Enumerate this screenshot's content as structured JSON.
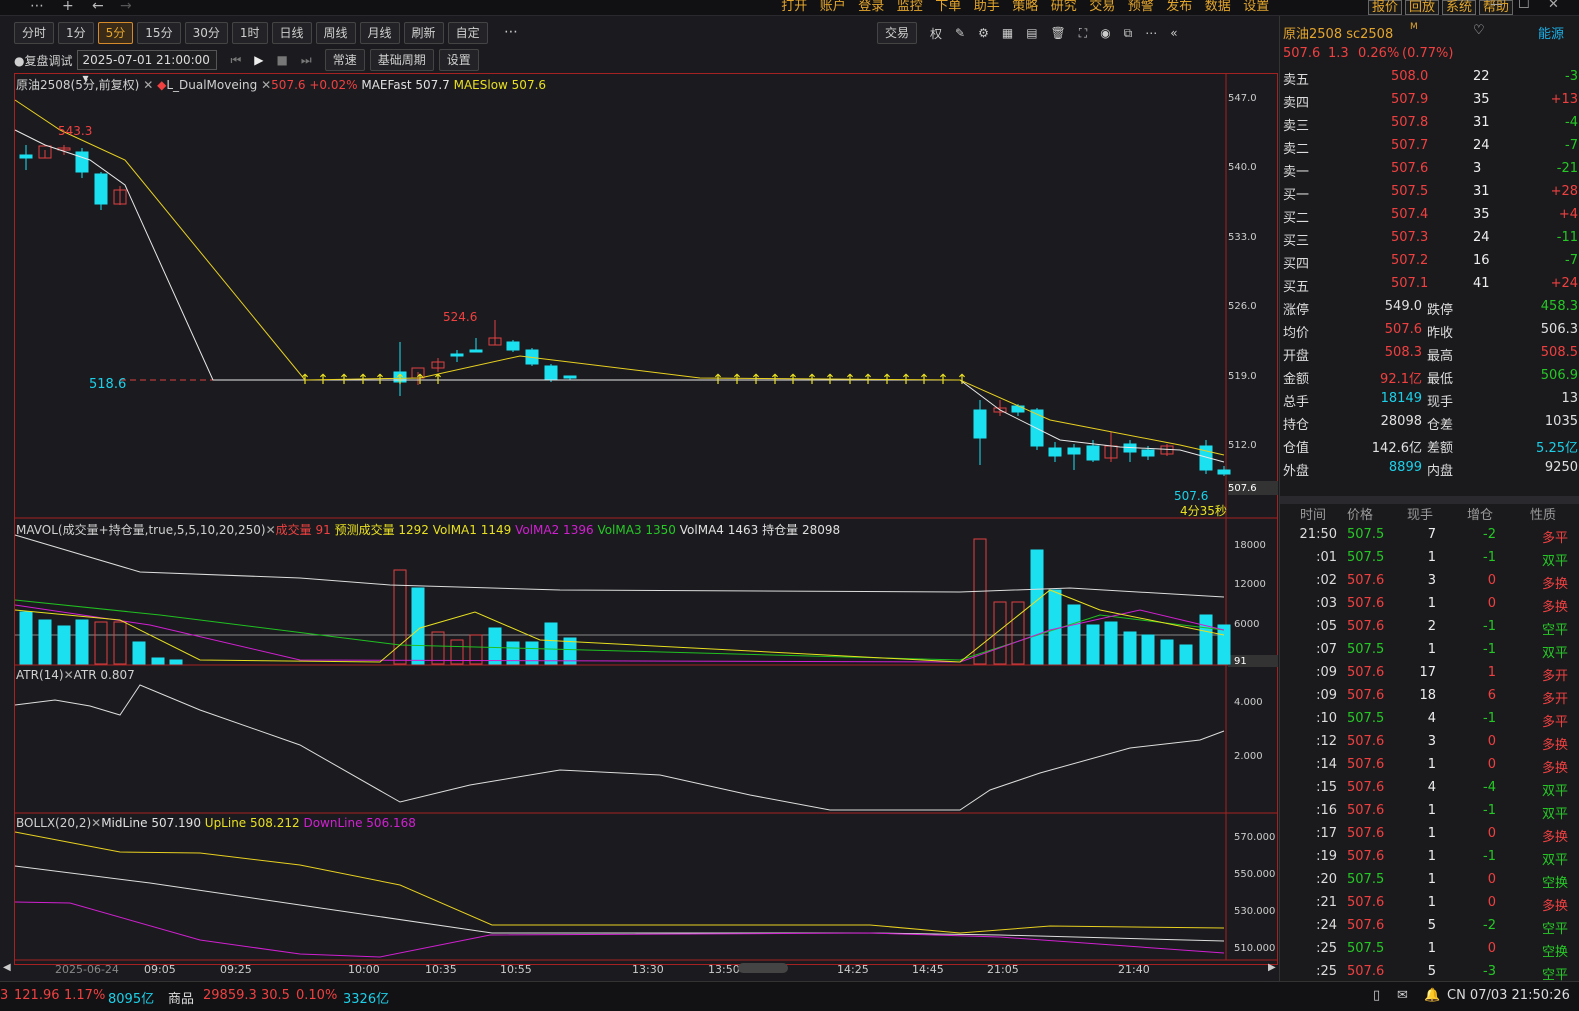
{
  "menu": [
    "打开",
    "账户",
    "登录",
    "监控",
    "下单",
    "助手",
    "策略",
    "研究",
    "交易",
    "预警",
    "发布",
    "数据",
    "设置"
  ],
  "menu_buttons": [
    "报价",
    "回放",
    "系统",
    "帮助"
  ],
  "periods": [
    "分时",
    "1分",
    "5分",
    "15分",
    "30分",
    "1时",
    "日线",
    "周线",
    "月线",
    "刷新",
    "自定"
  ],
  "active_period": "5分",
  "toolbar2": {
    "mode": "●复盘调试",
    "date": "2025-07-01 21:00:00",
    "speed": "常速",
    "base": "基础周期",
    "settings": "设置"
  },
  "trade_btn": "交易",
  "quan": "权",
  "main_label": {
    "name": "原油2508(5分,前复权)",
    "strategy": "L_DualMoveing",
    "price": "507.6 +0.02%",
    "fast": "MAEFast 507.7",
    "slow": "MAESlow 507.6"
  },
  "main_scale": [
    "547.0",
    "540.0",
    "533.0",
    "526.0",
    "519.0",
    "512.0",
    "507.6"
  ],
  "annotations": {
    "high": "543.3",
    "peak": "524.6",
    "low": "518.6",
    "last": "507.6",
    "timer": "4分35秒"
  },
  "vol_label": {
    "name": "MAVOL(成交量+持仓量,true,5,5,10,20,250)",
    "vol": "成交量 91",
    "pred": "预测成交量 1292",
    "ma1": "VolMA1 1149",
    "ma2": "VolMA2 1396",
    "ma3": "VolMA3 1350",
    "ma4": "VolMA4 1463",
    "oi": "持仓量 28098"
  },
  "vol_scale": [
    "18000",
    "12000",
    "6000",
    "91"
  ],
  "atr_label": {
    "name": "ATR(14)",
    "value": "ATR 0.807"
  },
  "atr_scale": [
    "4.000",
    "2.000"
  ],
  "boll_label": {
    "name": "BOLLX(20,2)",
    "mid": "MidLine 507.190",
    "up": "UpLine 508.212",
    "down": "DownLine 506.168"
  },
  "boll_scale": [
    "570.000",
    "550.000",
    "530.000",
    "510.000"
  ],
  "time_axis": [
    "2025-06-24",
    "09:05",
    "09:25",
    "10:00",
    "10:35",
    "10:55",
    "13:30",
    "13:50",
    "14:25",
    "14:45",
    "21:05",
    "21:40"
  ],
  "quote": {
    "title": "原油2508 sc2508",
    "flag": "M",
    "exchange": "能源",
    "price": "507.6",
    "chg": "1.3",
    "pct": "0.26%",
    "pct2": "(0.77%)"
  },
  "asks": [
    [
      "卖五",
      "508.0",
      "22",
      "-3"
    ],
    [
      "卖四",
      "507.9",
      "35",
      "+13"
    ],
    [
      "卖三",
      "507.8",
      "31",
      "-4"
    ],
    [
      "卖二",
      "507.7",
      "24",
      "-7"
    ],
    [
      "卖一",
      "507.6",
      "3",
      "-21"
    ]
  ],
  "bids": [
    [
      "买一",
      "507.5",
      "31",
      "+28"
    ],
    [
      "买二",
      "507.4",
      "35",
      "+4"
    ],
    [
      "买三",
      "507.3",
      "24",
      "-11"
    ],
    [
      "买四",
      "507.2",
      "16",
      "-7"
    ],
    [
      "买五",
      "507.1",
      "41",
      "+24"
    ]
  ],
  "stats": [
    [
      "涨停",
      "549.0",
      "跌停",
      "458.3"
    ],
    [
      "均价",
      "507.6",
      "昨收",
      "506.3"
    ],
    [
      "开盘",
      "508.3",
      "最高",
      "508.5"
    ],
    [
      "金额",
      "92.1亿",
      "最低",
      "506.9"
    ],
    [
      "总手",
      "18149",
      "现手",
      "13"
    ],
    [
      "持仓",
      "28098",
      "仓差",
      "1035"
    ],
    [
      "仓值",
      "142.6亿",
      "差额",
      "5.25亿"
    ],
    [
      "外盘",
      "8899",
      "内盘",
      "9250"
    ]
  ],
  "ticks_header": [
    "时间",
    "价格",
    "现手",
    "增仓",
    "性质"
  ],
  "ticks": [
    [
      "21:50",
      "507.5",
      "7",
      "-2",
      "多平"
    ],
    [
      ":01",
      "507.5",
      "1",
      "-1",
      "双平"
    ],
    [
      ":02",
      "507.6",
      "3",
      "0",
      "多换"
    ],
    [
      ":03",
      "507.6",
      "1",
      "0",
      "多换"
    ],
    [
      ":05",
      "507.6",
      "2",
      "-1",
      "空平"
    ],
    [
      ":07",
      "507.5",
      "1",
      "-1",
      "双平"
    ],
    [
      ":09",
      "507.6",
      "17",
      "1",
      "多开"
    ],
    [
      ":09",
      "507.6",
      "18",
      "6",
      "多开"
    ],
    [
      ":10",
      "507.5",
      "4",
      "-1",
      "多平"
    ],
    [
      ":12",
      "507.6",
      "3",
      "0",
      "多换"
    ],
    [
      ":14",
      "507.6",
      "1",
      "0",
      "多换"
    ],
    [
      ":15",
      "507.6",
      "4",
      "-4",
      "双平"
    ],
    [
      ":16",
      "507.6",
      "1",
      "-1",
      "双平"
    ],
    [
      ":17",
      "507.6",
      "1",
      "0",
      "多换"
    ],
    [
      ":19",
      "507.6",
      "1",
      "-1",
      "双平"
    ],
    [
      ":20",
      "507.5",
      "1",
      "0",
      "空换"
    ],
    [
      ":21",
      "507.6",
      "1",
      "0",
      "多换"
    ],
    [
      ":24",
      "507.6",
      "5",
      "-2",
      "空平"
    ],
    [
      ":25",
      "507.5",
      "1",
      "0",
      "空换"
    ],
    [
      ":25",
      "507.6",
      "5",
      "-3",
      "空平"
    ]
  ],
  "status": {
    "v1": "121.96",
    "v2": "1.17%",
    "v3": "8095亿",
    "name": "商品",
    "p": "29859.3",
    "c": "30.5",
    "pc": "0.10%",
    "amt": "3326亿",
    "clock": "CN 07/03 21:50:26"
  }
}
